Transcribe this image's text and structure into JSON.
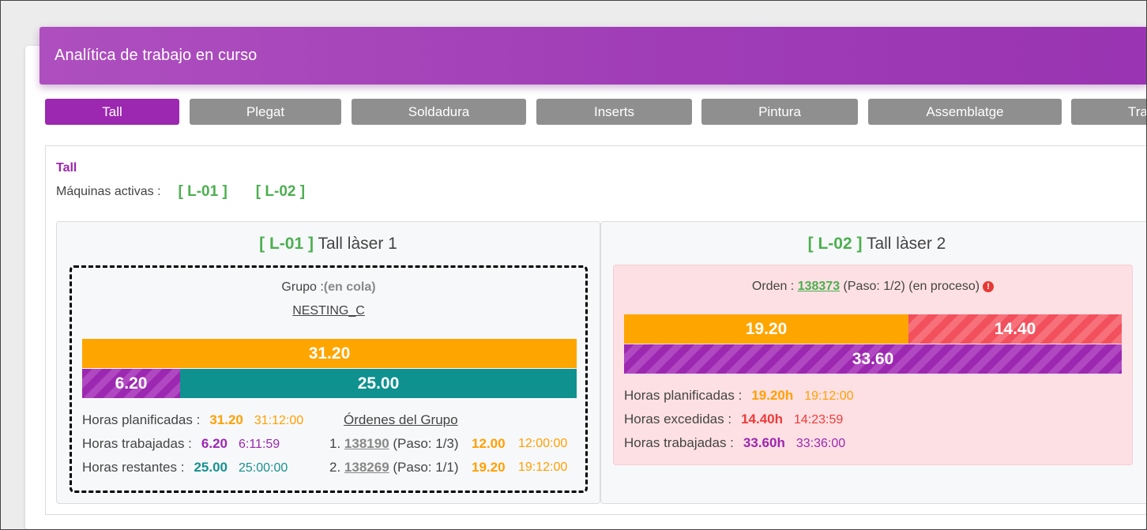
{
  "header": {
    "title": "Analítica de trabajo en curso"
  },
  "tabs": [
    {
      "label": "Tall",
      "active": true
    },
    {
      "label": "Plegat"
    },
    {
      "label": "Soldadura"
    },
    {
      "label": "Inserts"
    },
    {
      "label": "Pintura"
    },
    {
      "label": "Assemblatge"
    },
    {
      "label": "Tra"
    }
  ],
  "section": {
    "title": "Tall",
    "machines_label": "Máquinas activas :",
    "machines": [
      "[ L-01 ]",
      "[ L-02 ]"
    ]
  },
  "machine1": {
    "code": "[ L-01 ]",
    "name": "Tall làser 1",
    "group_label": "Grupo :",
    "group_status": "(en cola)",
    "group_name": "NESTING_C",
    "bars": {
      "planned": "31.20",
      "worked": "6.20",
      "remaining": "25.00",
      "worked_fraction": 0.198
    },
    "stats": {
      "planned_label": "Horas planificadas :",
      "planned_value": "31.20",
      "planned_time": "31:12:00",
      "worked_label": "Horas trabajadas :",
      "worked_value": "6.20",
      "worked_time": "6:11:59",
      "remaining_label": "Horas restantes :",
      "remaining_value": "25.00",
      "remaining_time": "25:00:00"
    },
    "orders_title": "Órdenes del Grupo",
    "orders": [
      {
        "index": "1.",
        "id": "138190",
        "step": "(Paso: 1/3)",
        "hours": "12.00",
        "time": "12:00:00"
      },
      {
        "index": "2.",
        "id": "138269",
        "step": "(Paso: 1/1)",
        "hours": "19.20",
        "time": "19:12:00"
      }
    ]
  },
  "machine2": {
    "code": "[ L-02 ]",
    "name": "Tall làser 2",
    "order_label": "Orden :",
    "order_id": "138373",
    "order_step": "(Paso: 1/2)",
    "order_status": "(en proceso)",
    "warning_icon": "exclamation-circle-icon",
    "bars": {
      "planned": "19.20",
      "exceeded": "14.40",
      "worked": "33.60",
      "planned_fraction": 0.571
    },
    "stats": {
      "planned_label": "Horas planificadas :",
      "planned_value": "19.20h",
      "planned_time": "19:12:00",
      "exceeded_label": "Horas excedidas :",
      "exceeded_value": "14.40h",
      "exceeded_time": "14:23:59",
      "worked_label": "Horas trabajadas :",
      "worked_value": "33.60h",
      "worked_time": "33:36:00"
    }
  },
  "colors": {
    "accent_purple": "#9c27b0",
    "orange": "#ffa500",
    "teal": "#0f9190",
    "green": "#4caf50",
    "red": "#f2505c",
    "tab_inactive": "#8f8f8f"
  }
}
